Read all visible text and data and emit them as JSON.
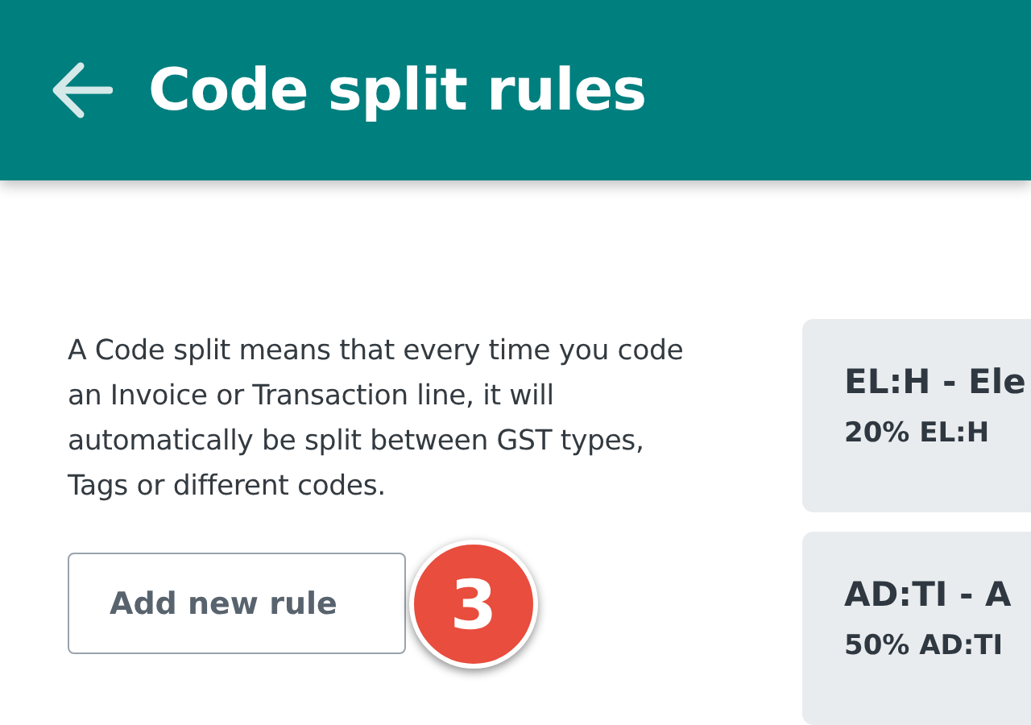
{
  "header": {
    "title": "Code split rules"
  },
  "description": "A Code split means that every time you code an Invoice or Transaction line, it will automatically be split between GST types, Tags or different codes.",
  "add_button": {
    "label": "Add new rule"
  },
  "step_badge": "3",
  "rules": [
    {
      "title": "EL:H - Ele",
      "split": "20% EL:H"
    },
    {
      "title": "AD:TI - A",
      "split": "50% AD:TI"
    }
  ]
}
